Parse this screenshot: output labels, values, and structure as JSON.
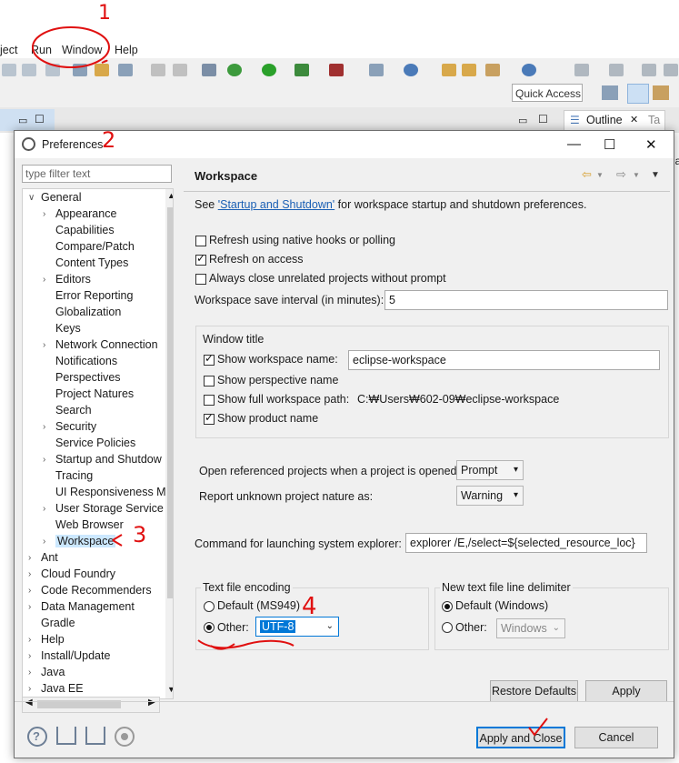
{
  "background": {
    "menu": [
      "ject",
      "Run",
      "Window",
      "Help"
    ],
    "quick_access": "Quick Access",
    "outline_tab": "Outline",
    "right_edge_tab": "Ta",
    "right_edge_text": "la"
  },
  "dialog": {
    "title": "Preferences",
    "filter_placeholder": "type filter text",
    "tree": [
      {
        "label": "General",
        "level": 0,
        "expanded": true
      },
      {
        "label": "Appearance",
        "level": 1,
        "arrow": true
      },
      {
        "label": "Capabilities",
        "level": 1
      },
      {
        "label": "Compare/Patch",
        "level": 1
      },
      {
        "label": "Content Types",
        "level": 1
      },
      {
        "label": "Editors",
        "level": 1,
        "arrow": true
      },
      {
        "label": "Error Reporting",
        "level": 1
      },
      {
        "label": "Globalization",
        "level": 1
      },
      {
        "label": "Keys",
        "level": 1
      },
      {
        "label": "Network Connection",
        "level": 1,
        "arrow": true
      },
      {
        "label": "Notifications",
        "level": 1
      },
      {
        "label": "Perspectives",
        "level": 1
      },
      {
        "label": "Project Natures",
        "level": 1
      },
      {
        "label": "Search",
        "level": 1
      },
      {
        "label": "Security",
        "level": 1,
        "arrow": true
      },
      {
        "label": "Service Policies",
        "level": 1
      },
      {
        "label": "Startup and Shutdow",
        "level": 1,
        "arrow": true
      },
      {
        "label": "Tracing",
        "level": 1
      },
      {
        "label": "UI Responsiveness M",
        "level": 1
      },
      {
        "label": "User Storage Service",
        "level": 1,
        "arrow": true
      },
      {
        "label": "Web Browser",
        "level": 1
      },
      {
        "label": "Workspace",
        "level": 1,
        "arrow": true,
        "selected": true
      },
      {
        "label": "Ant",
        "level": 0,
        "arrow": true
      },
      {
        "label": "Cloud Foundry",
        "level": 0,
        "arrow": true
      },
      {
        "label": "Code Recommenders",
        "level": 0,
        "arrow": true
      },
      {
        "label": "Data Management",
        "level": 0,
        "arrow": true
      },
      {
        "label": "Gradle",
        "level": 0
      },
      {
        "label": "Help",
        "level": 0,
        "arrow": true
      },
      {
        "label": "Install/Update",
        "level": 0,
        "arrow": true
      },
      {
        "label": "Java",
        "level": 0,
        "arrow": true
      },
      {
        "label": "Java EE",
        "level": 0,
        "arrow": true
      }
    ],
    "page_title": "Workspace",
    "see_prefix": "See ",
    "see_link": "'Startup and Shutdown'",
    "see_suffix": " for workspace startup and shutdown preferences.",
    "refresh_native": "Refresh using native hooks or polling",
    "refresh_access": "Refresh on access",
    "always_close": "Always close unrelated projects without prompt",
    "save_interval_label": "Workspace save interval (in minutes):",
    "save_interval_value": "5",
    "window_title_group": "Window title",
    "show_ws_name": "Show workspace name:",
    "ws_name_value": "eclipse-workspace",
    "show_perspective": "Show perspective name",
    "show_full_path": "Show full workspace path:",
    "full_path_value": "C:₩Users₩602-09₩eclipse-workspace",
    "show_product": "Show product name",
    "open_ref_label": "Open referenced projects when a project is opened:",
    "open_ref_value": "Prompt",
    "report_nature_label": "Report unknown project nature as:",
    "report_nature_value": "Warning",
    "cmd_label": "Command for launching system explorer:",
    "cmd_value": "explorer /E,/select=${selected_resource_loc}",
    "encoding_group": "Text file encoding",
    "enc_default": "Default (MS949)",
    "enc_other": "Other:",
    "enc_value": "UTF-8",
    "delim_group": "New text file line delimiter",
    "delim_default": "Default (Windows)",
    "delim_other": "Other:",
    "delim_value": "Windows",
    "restore_defaults": "Restore Defaults",
    "apply": "Apply",
    "apply_close": "Apply and Close",
    "cancel": "Cancel"
  },
  "annotations": [
    "1",
    "2",
    "3",
    "4"
  ],
  "colors": {
    "selection": "#cce8ff",
    "annotation": "#e01010",
    "enc_highlight": "#0078d7"
  }
}
